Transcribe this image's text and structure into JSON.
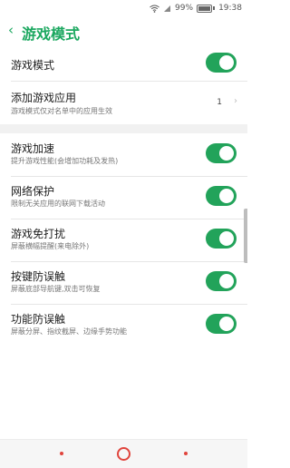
{
  "status_bar": {
    "battery_percent": "99%",
    "battery_level": 0.99,
    "time": "19:38",
    "icons": [
      "wifi-icon",
      "signal-icon",
      "battery-icon"
    ]
  },
  "header": {
    "back_glyph": "‹",
    "title": "游戏模式"
  },
  "settings": {
    "game_mode": {
      "label": "游戏模式",
      "enabled": true
    },
    "add_game_apps": {
      "label": "添加游戏应用",
      "sub": "游戏模式仅对名单中的应用生效",
      "count": "1",
      "chevron": "›"
    },
    "game_acceleration": {
      "label": "游戏加速",
      "sub": "提升游戏性能(会增加功耗及发热)",
      "enabled": true
    },
    "network_protection": {
      "label": "网络保护",
      "sub": "限制无关应用的联网下载活动",
      "enabled": true
    },
    "do_not_disturb": {
      "label": "游戏免打扰",
      "sub": "屏蔽横幅提醒(来电除外)",
      "enabled": true
    },
    "button_protection": {
      "label": "按键防误触",
      "sub": "屏蔽底部导航键,双击可恢复",
      "enabled": true
    },
    "gesture_protection": {
      "label": "功能防误触",
      "sub": "屏蔽分屏、指纹截屏、边缘手势功能",
      "enabled": true
    }
  },
  "colors": {
    "accent": "#1ca860",
    "toggle_on": "#22a35a",
    "nav_accent": "#e0443c"
  },
  "nav_bar": {
    "buttons": [
      "back-button",
      "home-button",
      "recents-button"
    ]
  }
}
